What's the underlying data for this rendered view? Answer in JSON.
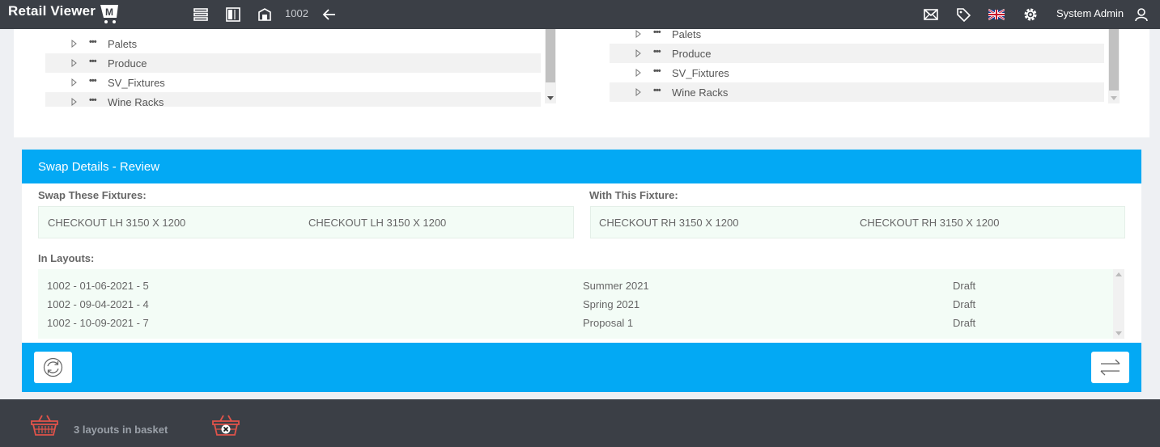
{
  "app": {
    "title": "Retail Viewer",
    "store_number": "1002",
    "user_name": "System Admin"
  },
  "left_tree": {
    "items": [
      {
        "label": "Palets"
      },
      {
        "label": "Produce"
      },
      {
        "label": "SV_Fixtures"
      },
      {
        "label": "Wine Racks"
      }
    ]
  },
  "right_tree": {
    "items": [
      {
        "label": "Palets"
      },
      {
        "label": "Produce"
      },
      {
        "label": "SV_Fixtures"
      },
      {
        "label": "Wine Racks"
      }
    ]
  },
  "swap": {
    "header": "Swap Details - Review",
    "from_label": "Swap These Fixtures:",
    "from_fixtures": [
      "CHECKOUT LH 3150 X 1200",
      "CHECKOUT LH 3150 X 1200"
    ],
    "to_label": "With This Fixture:",
    "to_fixtures": [
      "CHECKOUT RH 3150 X 1200",
      "CHECKOUT RH 3150 X 1200"
    ],
    "layouts_label": "In Layouts:",
    "layouts": [
      {
        "id": "1002 - 01-06-2021 - 5",
        "name": "Summer 2021",
        "status": "Draft"
      },
      {
        "id": "1002 - 09-04-2021 - 4",
        "name": "Spring 2021",
        "status": "Draft"
      },
      {
        "id": "1002 - 10-09-2021 - 7",
        "name": "Proposal 1",
        "status": "Draft"
      }
    ]
  },
  "basket": {
    "text": "3 layouts in basket"
  },
  "icons": {
    "list": "list-icon",
    "panel": "columns-icon",
    "store": "store-icon",
    "back": "arrow-left-icon",
    "mail": "mail-icon",
    "tag": "tag-icon",
    "flag": "uk-flag-icon",
    "settings": "gear-icon",
    "user": "user-icon",
    "reset": "refresh-icon",
    "swap": "swap-arrows-icon",
    "basket": "basket-icon",
    "clear_basket": "basket-clear-icon"
  },
  "colors": {
    "topbar": "#3b3f46",
    "accent": "#03a9f4",
    "light_green": "#f3fcf6",
    "basket_red": "#e0534a"
  }
}
